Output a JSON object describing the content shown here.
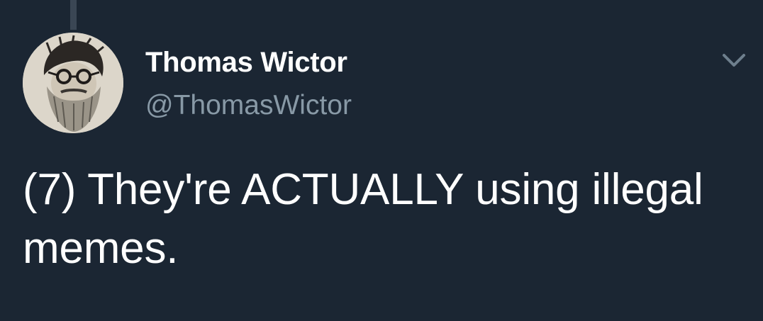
{
  "tweet": {
    "author": {
      "display_name": "Thomas Wictor",
      "handle": "@ThomasWictor"
    },
    "text": "(7) They're ACTUALLY using illegal memes."
  },
  "icons": {
    "avatar": "avatar-image",
    "menu": "chevron-down-icon"
  },
  "colors": {
    "background": "#1b2633",
    "primary_text": "#ffffff",
    "secondary_text": "#8899a6",
    "thread_line": "#3a4654"
  }
}
